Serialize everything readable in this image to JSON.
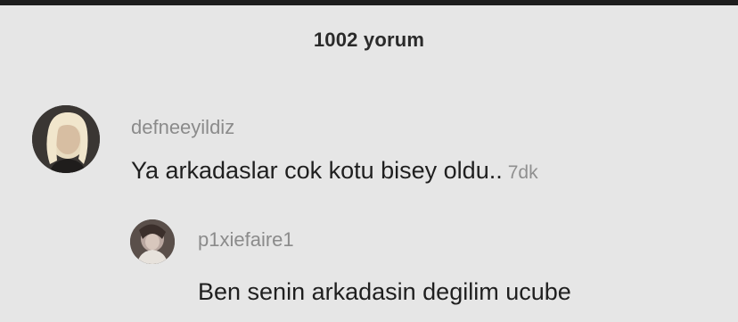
{
  "header": {
    "title": "1002 yorum"
  },
  "comments": [
    {
      "username": "defneeyildiz",
      "text": "Ya arkadaslar cok kotu bisey oldu..",
      "time": "7dk",
      "avatar_icon": "profile-photo-blonde"
    }
  ],
  "reply": {
    "username": "p1xiefaire1",
    "text": "Ben senin arkadasin degilim ucube",
    "avatar_icon": "profile-photo"
  }
}
